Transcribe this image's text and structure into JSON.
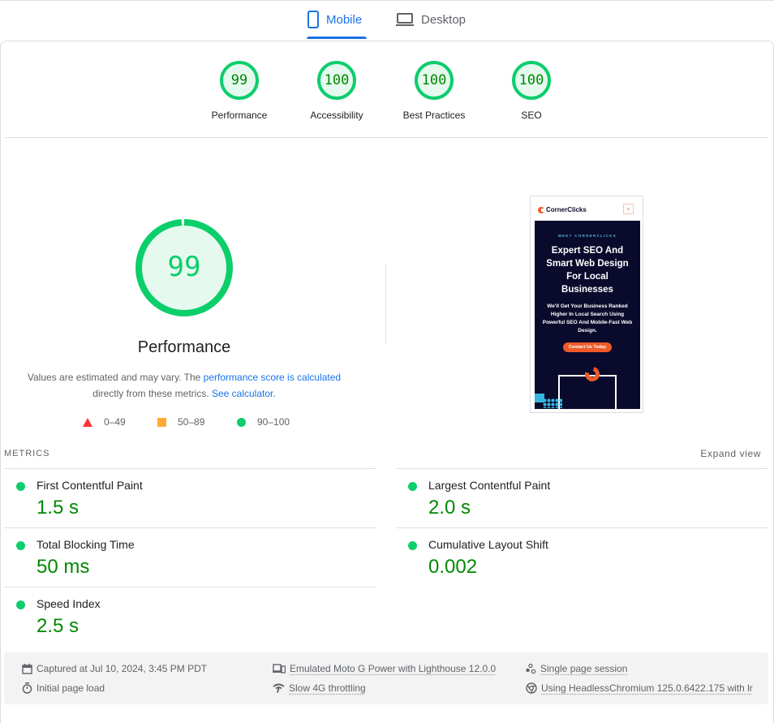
{
  "tabs": [
    {
      "label": "Mobile",
      "icon": "smartphone-icon",
      "active": true
    },
    {
      "label": "Desktop",
      "icon": "laptop-icon",
      "active": false
    }
  ],
  "colors": {
    "accent": "#1a73e8",
    "pass": "#0cce6b",
    "pass_text": "#008800",
    "average": "#ffaa33",
    "fail": "#ff3333",
    "gauge_fill": "#e5f9ee"
  },
  "summary": {
    "categories": [
      {
        "label": "Performance",
        "score": 99
      },
      {
        "label": "Accessibility",
        "score": 100
      },
      {
        "label": "Best Practices",
        "score": 100
      },
      {
        "label": "SEO",
        "score": 100
      }
    ]
  },
  "performance": {
    "score": 99,
    "title": "Performance",
    "desc_prefix": "Values are estimated and may vary. The ",
    "desc_link1": "performance score is calculated",
    "desc_middle": " directly from these metrics. ",
    "desc_link2": "See calculator.",
    "legend": [
      {
        "shape": "triangle",
        "range": "0–49"
      },
      {
        "shape": "square",
        "range": "50–89"
      },
      {
        "shape": "circle",
        "range": "90–100"
      }
    ]
  },
  "screenshot": {
    "brand": "CornerClicks",
    "kicker": "MEET CORNERCLICKS",
    "headline": "Expert SEO And Smart Web Design For Local Businesses",
    "subtext": "We'll Get Your Business Ranked Higher In Local Search Using Powerful SEO And Mobile-Fast Web Design.",
    "cta": "Contact Us Today"
  },
  "metrics": {
    "header": "METRICS",
    "expand_label": "Expand view",
    "items": [
      {
        "name": "First Contentful Paint",
        "value": "1.5 s",
        "rating": "pass"
      },
      {
        "name": "Largest Contentful Paint",
        "value": "2.0 s",
        "rating": "pass"
      },
      {
        "name": "Total Blocking Time",
        "value": "50 ms",
        "rating": "pass"
      },
      {
        "name": "Cumulative Layout Shift",
        "value": "0.002",
        "rating": "pass"
      },
      {
        "name": "Speed Index",
        "value": "2.5 s",
        "rating": "pass"
      }
    ]
  },
  "footer": {
    "captured": "Captured at Jul 10, 2024, 3:45 PM PDT",
    "initial_load": "Initial page load",
    "device": "Emulated Moto G Power with Lighthouse 12.0.0",
    "throttling": "Slow 4G throttling",
    "session": "Single page session",
    "browser": "Using HeadlessChromium 125.0.6422.175 with lr"
  }
}
